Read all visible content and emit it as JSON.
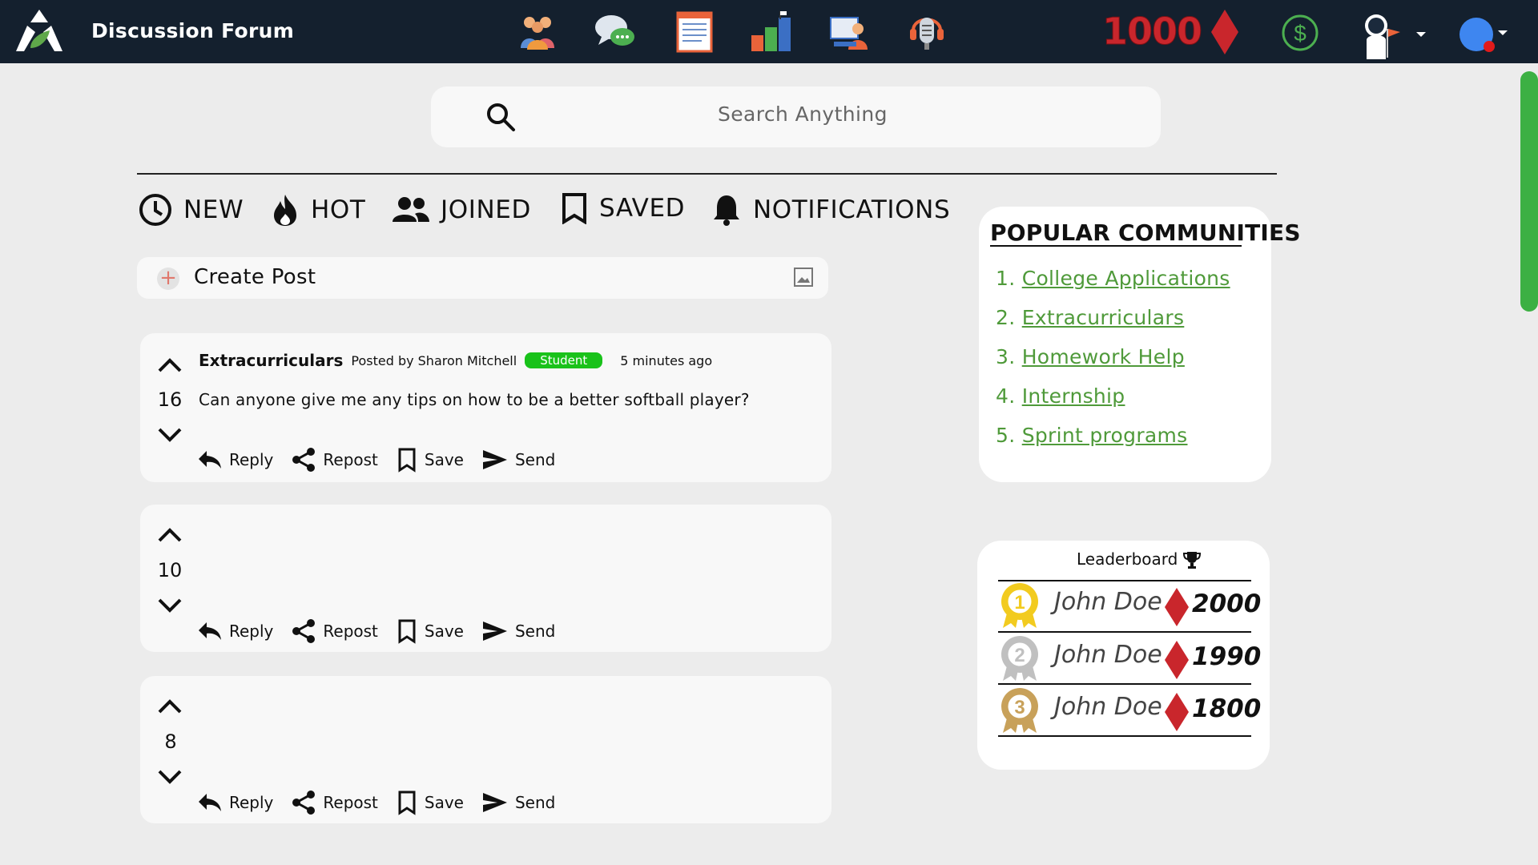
{
  "header": {
    "title": "Discussion Forum",
    "coin_count": "1000",
    "nav_icons": [
      "community-icon",
      "chat-icon",
      "notes-icon",
      "progress-icon",
      "tutoring-icon",
      "podcast-icon"
    ]
  },
  "search": {
    "placeholder": "Search Anything"
  },
  "filters": [
    {
      "label": "NEW",
      "icon": "clock-icon"
    },
    {
      "label": "HOT",
      "icon": "flame-icon"
    },
    {
      "label": "JOINED",
      "icon": "people-icon"
    },
    {
      "label": "SAVED",
      "icon": "bookmark-icon"
    },
    {
      "label": "NOTIFICATIONS",
      "icon": "bell-icon"
    }
  ],
  "create_post": {
    "label": "Create Post"
  },
  "posts": [
    {
      "votes": "16",
      "community": "Extracurriculars",
      "posted_by": "Posted by Sharon Mitchell",
      "role": "Student",
      "time": "5 minutes ago",
      "text": "Can anyone give me any tips on how to be a better softball player?"
    },
    {
      "votes": "10"
    },
    {
      "votes": "8"
    }
  ],
  "actions": {
    "reply": "Reply",
    "repost": "Repost",
    "save": "Save",
    "send": "Send"
  },
  "popular": {
    "title": "POPULAR COMMUNITIES",
    "items": [
      {
        "num": "1.",
        "label": "College Applications"
      },
      {
        "num": "2.",
        "label": "Extracurriculars"
      },
      {
        "num": "3.",
        "label": "Homework Help"
      },
      {
        "num": "4.",
        "label": "Internship"
      },
      {
        "num": "5.",
        "label": "Sprint programs"
      }
    ]
  },
  "leaderboard": {
    "title": "Leaderboard",
    "entries": [
      {
        "rank": "1",
        "name": "John Doe",
        "score": "2000",
        "medal_color": "#f2cb1f"
      },
      {
        "rank": "2",
        "name": "John Doe",
        "score": "1990",
        "medal_color": "#c0c0c0"
      },
      {
        "rank": "3",
        "name": "John Doe",
        "score": "1800",
        "medal_color": "#c8a15a"
      }
    ]
  },
  "colors": {
    "accent": "#4f9a3a",
    "diamond": "#c9262c",
    "badge": "#19c21a",
    "topbar": "#14202e"
  }
}
